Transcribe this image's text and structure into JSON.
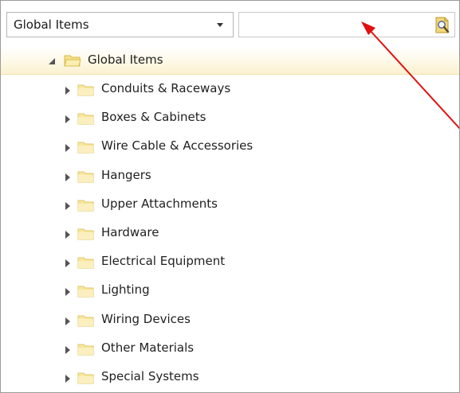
{
  "scope_select": {
    "selected": "Global Items"
  },
  "search": {
    "value": "",
    "placeholder": ""
  },
  "tree": {
    "root": {
      "label": "Global Items",
      "expanded": true
    },
    "items": [
      {
        "label": "Conduits & Raceways"
      },
      {
        "label": "Boxes & Cabinets"
      },
      {
        "label": "Wire Cable & Accessories"
      },
      {
        "label": "Hangers"
      },
      {
        "label": "Upper Attachments"
      },
      {
        "label": "Hardware"
      },
      {
        "label": "Electrical Equipment"
      },
      {
        "label": "Lighting"
      },
      {
        "label": "Wiring Devices"
      },
      {
        "label": "Other Materials"
      },
      {
        "label": "Special Systems"
      }
    ]
  },
  "colors": {
    "annotation_arrow": "#e01010",
    "root_highlight": "#fbf1cf",
    "folder_fill": "#f6e08a",
    "folder_edge": "#d9b94a"
  },
  "icons": {
    "combo_dropdown": "chevron-down-icon",
    "search_button": "magnifier-document-icon",
    "root_expander": "expanded-triangle-icon",
    "item_expander": "collapsed-triangle-icon",
    "folder": "folder-icon"
  }
}
